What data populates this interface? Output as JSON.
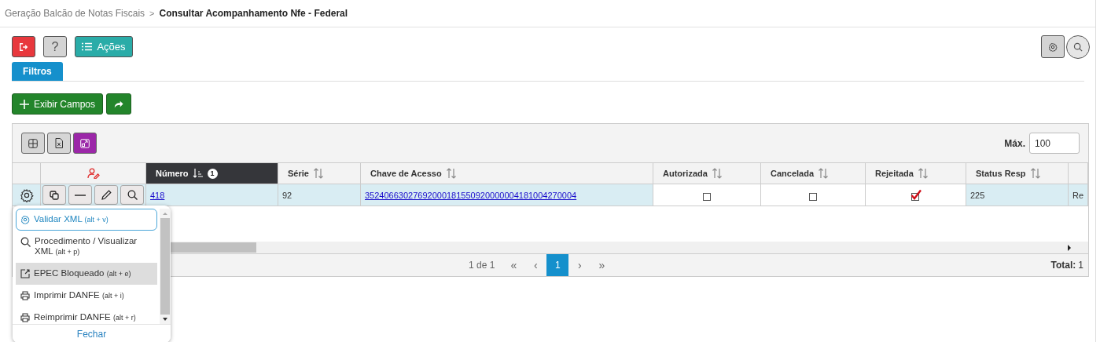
{
  "breadcrumb": {
    "parent": "Geração Balcão de Notas Fiscais",
    "separator": ">",
    "current": "Consultar Acompanhamento Nfe - Federal"
  },
  "toolbar": {
    "actions_label": "Ações",
    "help_label": "?"
  },
  "tabs": [
    {
      "label": "Filtros",
      "selected": true
    }
  ],
  "show_fields_label": "Exibir Campos",
  "grid": {
    "max_label": "Máx.",
    "max_value": "100",
    "columns": [
      {
        "kind": "select"
      },
      {
        "kind": "actions"
      },
      {
        "kind": "data",
        "label": "Número",
        "sorted": true,
        "sort_order": "1"
      },
      {
        "kind": "data",
        "label": "Série",
        "sorted": false
      },
      {
        "kind": "data",
        "label": "Chave de Acesso",
        "sorted": false
      },
      {
        "kind": "data",
        "label": "Autorizada",
        "sorted": false
      },
      {
        "kind": "data",
        "label": "Cancelada",
        "sorted": false
      },
      {
        "kind": "data",
        "label": "Rejeitada",
        "sorted": false
      },
      {
        "kind": "data",
        "label": "Status Resp",
        "sorted": false
      },
      {
        "kind": "blank"
      }
    ],
    "rows": [
      {
        "selected": true,
        "cells": [
          {
            "kind": "gear"
          },
          {
            "kind": "actions"
          },
          {
            "kind": "link",
            "text": "418"
          },
          {
            "kind": "text",
            "text": "92"
          },
          {
            "kind": "link",
            "text": "35240663027692000181550920000004181004270004"
          },
          {
            "kind": "check",
            "checked": false
          },
          {
            "kind": "check",
            "checked": false
          },
          {
            "kind": "check",
            "checked": true
          },
          {
            "kind": "text",
            "text": "225"
          },
          {
            "kind": "text",
            "text": "Re"
          }
        ]
      }
    ],
    "pager": {
      "summary": "1 de 1",
      "first": "«",
      "prev": "‹",
      "pages": [
        {
          "label": "1",
          "selected": true
        }
      ],
      "next": "›",
      "last": "»",
      "total_label": "Total:",
      "total_value": "1"
    }
  },
  "menu": {
    "items": [
      {
        "kind": "validate",
        "label": "Validar XML",
        "shortcut": "(alt + v)",
        "focused": true,
        "highlighted": false
      },
      {
        "kind": "view",
        "label": "Procedimento / Visualizar XML",
        "shortcut": "(alt + p)",
        "focused": false,
        "highlighted": false
      },
      {
        "kind": "open",
        "label": "EPEC Bloqueado",
        "shortcut": "(alt + e)",
        "focused": false,
        "highlighted": true
      },
      {
        "kind": "print",
        "label": "Imprimir DANFE",
        "shortcut": "(alt + i)",
        "focused": false,
        "highlighted": false
      },
      {
        "kind": "print",
        "label": "Reimprimir DANFE",
        "shortcut": "(alt + r)",
        "focused": false,
        "highlighted": false
      }
    ],
    "close_label": "Fechar"
  }
}
